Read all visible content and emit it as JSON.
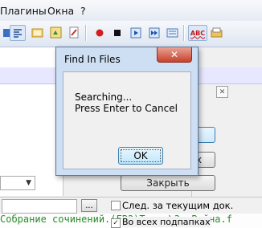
{
  "menubar": {
    "items": [
      "Плагины",
      "Окна",
      "?"
    ]
  },
  "toolbar": {
    "icons": [
      "word-wrap-icon",
      "show-all-chars-icon",
      "indent-guide-icon",
      "doc-map-icon",
      "function-list-icon",
      "record-macro-icon",
      "stop-macro-icon",
      "play-macro-icon",
      "run-macro-multiple-icon",
      "save-macro-icon",
      "spellcheck-icon",
      "spellcheck-settings-icon"
    ],
    "spellcheck_label": "ABC"
  },
  "find_panel": {
    "partial_button_label": "ax",
    "close_button_label": "Закрыть",
    "ellipsis_label": "...",
    "follow_doc_label": "След. за текущим док.",
    "all_subfolders_label": "Во всех подпапках"
  },
  "status": {
    "text": "Собрание сочинений.(FB2)",
    "tail": "Треки\\3. Война.f"
  },
  "dialog": {
    "title": "Find In Files",
    "close_glyph": "✕",
    "message_line1": "Searching...",
    "message_line2": "Press Enter to Cancel",
    "ok_label": "OK"
  }
}
